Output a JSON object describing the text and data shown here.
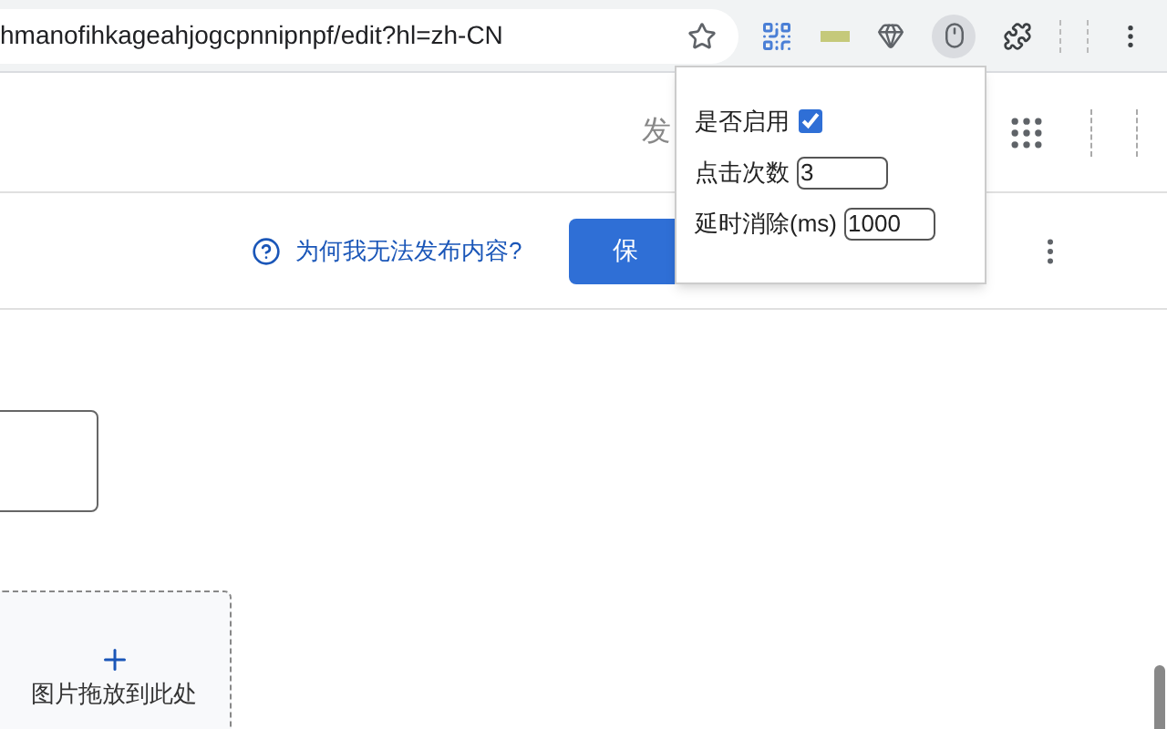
{
  "address_bar": {
    "url": "hmanofihkageahjogcpnnipnpf/edit?hl=zh-CN"
  },
  "header": {
    "partial_text": "发"
  },
  "action_bar": {
    "help_link": "为何我无法发布内容?",
    "save_button": "保"
  },
  "dropzone": {
    "hint": "图片拖放到此处"
  },
  "popup": {
    "rows": [
      {
        "kind": "checkbox",
        "label": "是否启用",
        "checked": true
      },
      {
        "kind": "input",
        "label": "点击次数",
        "value": "3"
      },
      {
        "kind": "input",
        "label": "延时消除(ms)",
        "value": "1000"
      }
    ]
  }
}
